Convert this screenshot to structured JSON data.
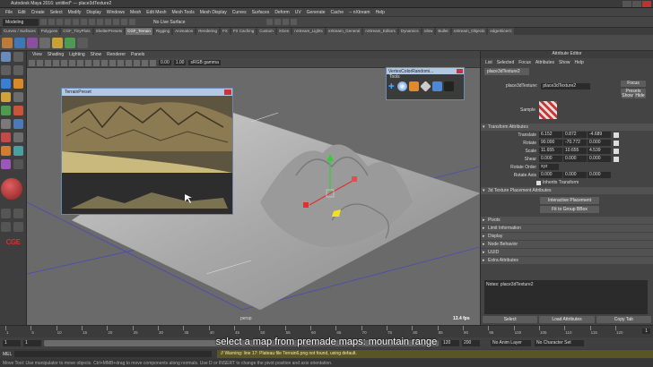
{
  "window": {
    "title": "Autodesk Maya 2016: untitled* --- place3dTexture2"
  },
  "menu": [
    "File",
    "Edit",
    "Create",
    "Select",
    "Modify",
    "Display",
    "Windows",
    "Mesh",
    "Edit Mesh",
    "Mesh Tools",
    "Mesh Display",
    "Curves",
    "Surfaces",
    "Deform",
    "UV",
    "Generate",
    "Cache",
    "-- nXtream",
    "Help"
  ],
  "status": {
    "mode": "Modeling",
    "live": "No Live Surface"
  },
  "shelf_tabs": [
    "Curves / Surfaces",
    "Polygons",
    "CGF_TinyPlots",
    "ShelterPresets",
    "CGF_Terrain",
    "Rigging",
    "Animation",
    "Rendering",
    "FX",
    "FX Caching",
    "Custom",
    "XGen",
    "nXtream_Lights",
    "nXtream_General",
    "nXtream_Editors",
    "Dynamics",
    "rdnw",
    "Bullet",
    "nXtream_Objects",
    "edgeSlicerC"
  ],
  "shelf_active": 4,
  "viewport": {
    "menu": [
      "View",
      "Shading",
      "Lighting",
      "Show",
      "Renderer",
      "Panels"
    ],
    "gamma": "sRGB gamma",
    "val1": "0.00",
    "val2": "1.00",
    "camera": "persp",
    "fps": "13.4 fps"
  },
  "terrain_preview": {
    "title": "TerrainPreset"
  },
  "vcr_panel": {
    "title": "VertexColorRandomi...",
    "tools_label": "Tools"
  },
  "attribute_editor": {
    "header": "Attribute Editor",
    "menu": [
      "List",
      "Selected",
      "Focus",
      "Attributes",
      "Show",
      "Help"
    ],
    "tab": "place3dTexture2",
    "node_label": "place3dTexture:",
    "node_value": "place3dTexture2",
    "buttons": [
      "Focus",
      "Presets"
    ],
    "show_hide": [
      "Show",
      "Hide"
    ],
    "sample_label": "Sample",
    "transform_section": "Transform Attributes",
    "rows": [
      {
        "label": "Translate",
        "values": [
          "6.152",
          "0.872",
          "-4.689"
        ]
      },
      {
        "label": "Rotate",
        "values": [
          "90.000",
          "-70.772",
          "0.000"
        ]
      },
      {
        "label": "Scale",
        "values": [
          "11.655",
          "10.655",
          "4.539"
        ]
      },
      {
        "label": "Shear",
        "values": [
          "0.000",
          "0.000",
          "0.000"
        ]
      }
    ],
    "rotate_order_label": "Rotate Order",
    "rotate_order": "xyz",
    "rotate_axis_label": "Rotate Axis",
    "rotate_axis": [
      "0.000",
      "0.000",
      "0.000"
    ],
    "inherits": "Inherits Transform",
    "placement_section": "3d Texture Placement Attributes",
    "placement_buttons": [
      "Interactive Placement",
      "Fit to Group BBox"
    ],
    "closed_sections": [
      "Pivots",
      "Limit Information",
      "Display",
      "Node Behavior",
      "UUID",
      "Extra Attributes"
    ],
    "notes": "Notes: place3dTexture2",
    "bottom_buttons": [
      "Select",
      "Load Attributes",
      "Copy Tab"
    ]
  },
  "timeline": {
    "ticks": [
      "1",
      "5",
      "10",
      "15",
      "20",
      "25",
      "30",
      "35",
      "40",
      "45",
      "50",
      "55",
      "60",
      "65",
      "70",
      "75",
      "80",
      "85",
      "90",
      "95",
      "100",
      "105",
      "110",
      "115",
      "120"
    ],
    "current": "1"
  },
  "range": {
    "start": "1",
    "start2": "1",
    "end": "120",
    "end2": "200",
    "anim_layer": "No Anim Layer",
    "char_set": "No Character Set"
  },
  "cmd": {
    "label": "MEL",
    "warning": "// Warning: line 17: Plateau file Terrain6.png not found, using default."
  },
  "help": "Move Tool: Use manipulator to move objects. Ctrl+MMB+drag to move components along normals. Use D or INSERT to change the pivot position and axis orientation.",
  "caption": "select a map from premade maps: mountain range",
  "colors": {
    "caption": "#ffffff",
    "shelf_active": "#6e6e6e",
    "warning_bar": "#3a3a3a"
  }
}
